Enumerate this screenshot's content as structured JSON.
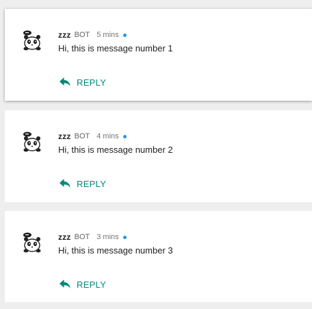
{
  "colors": {
    "accent": "#00897b",
    "status_dot": "#2196f3",
    "background": "#eeeeee",
    "card": "#ffffff"
  },
  "messages": [
    {
      "username": "zzz",
      "tag": "BOT",
      "time": "5 mins",
      "text": "Hi, this is message number 1",
      "reply_label": "REPLY",
      "avatar_icon": "panda-avatar-icon",
      "reply_icon": "reply-arrow-icon"
    },
    {
      "username": "zzz",
      "tag": "BOT",
      "time": "4 mins",
      "text": "Hi, this is message number 2",
      "reply_label": "REPLY",
      "avatar_icon": "panda-avatar-icon",
      "reply_icon": "reply-arrow-icon"
    },
    {
      "username": "zzz",
      "tag": "BOT",
      "time": "3 mins",
      "text": "Hi, this is message number 3",
      "reply_label": "REPLY",
      "avatar_icon": "panda-avatar-icon",
      "reply_icon": "reply-arrow-icon"
    }
  ]
}
